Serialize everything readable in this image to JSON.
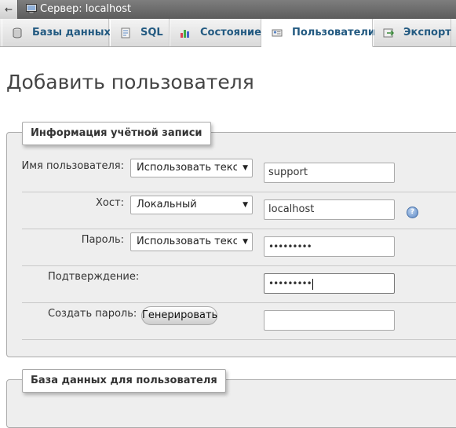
{
  "topbar": {
    "back_arrow": "←",
    "server_label": "Сервер: localhost",
    "server_icon": "server-icon"
  },
  "tabs": [
    {
      "label": "Базы данных",
      "icon": "database-icon"
    },
    {
      "label": "SQL",
      "icon": "sql-icon"
    },
    {
      "label": "Состояние",
      "icon": "status-chart-icon"
    },
    {
      "label": "Пользователи",
      "icon": "users-icon",
      "active": true
    },
    {
      "label": "Экспорт",
      "icon": "export-icon"
    }
  ],
  "page_title": "Добавить пользователя",
  "account_section": {
    "legend": "Информация учётной записи",
    "username": {
      "label": "Имя пользователя:",
      "select_value": "Использовать текстовое поле",
      "value": "support"
    },
    "host": {
      "label": "Хост:",
      "select_value": "Локальный",
      "value": "localhost",
      "help_icon": "help-icon"
    },
    "password": {
      "label": "Пароль:",
      "select_value": "Использовать текстовое поле",
      "value": "•••••••••"
    },
    "confirm": {
      "label": "Подтверждение:",
      "value": "•••••••••"
    },
    "generate": {
      "label": "Создать пароль:",
      "button": "Генерировать",
      "value": ""
    }
  },
  "database_section": {
    "legend": "База данных для пользователя"
  },
  "colors": {
    "tab_text": "#235a81",
    "fieldset_bg": "#eeeeee",
    "topbar_bg": "#6b6b6b"
  }
}
